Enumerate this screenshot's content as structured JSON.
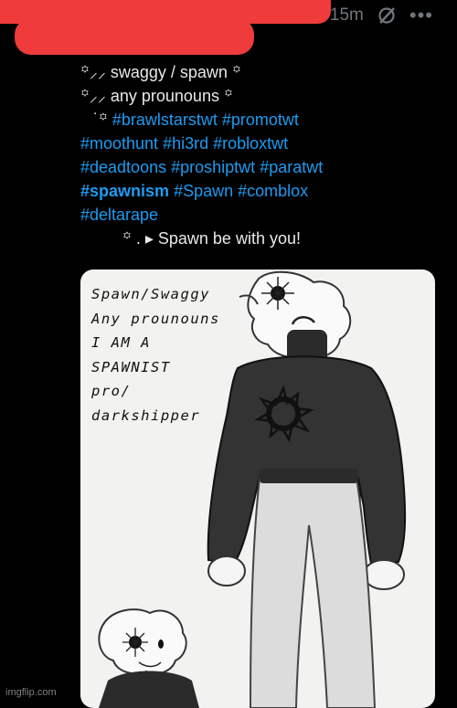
{
  "header": {
    "timestamp": "15m",
    "grok_icon": "grok-icon",
    "more_icon": "more-icon"
  },
  "tweet": {
    "lines": [
      {
        "prefix": "꙳⸝⸝",
        "text": " swaggy / spawn ",
        "suffix": "꙳"
      },
      {
        "prefix": "꙳⸝⸝",
        "text": " any prounouns ",
        "suffix": "꙳"
      }
    ],
    "hashtag_prefix": "˙꙳ ",
    "hashtags": [
      [
        "#brawlstarstwt",
        "#promotwt"
      ],
      [
        "#moothunt",
        "#hi3rd",
        "#robloxtwt"
      ],
      [
        "#deadtoons",
        "#proshiptwt",
        "#paratwt"
      ],
      [
        "#spawnism",
        "#Spawn",
        "#comblox"
      ],
      [
        "#deltarape"
      ]
    ],
    "signoff": "꙳ . ▸ Spawn be with you!"
  },
  "card": {
    "lines": [
      "Spawn/Swaggy",
      "Any prounouns",
      "I AM A",
      "SPAWNIST",
      "pro/",
      "darkshipper"
    ]
  },
  "watermark": "imgflip.com",
  "colors": {
    "accent": "#1d9bf0",
    "redaction": "#ef3b3b",
    "background": "#000000"
  }
}
